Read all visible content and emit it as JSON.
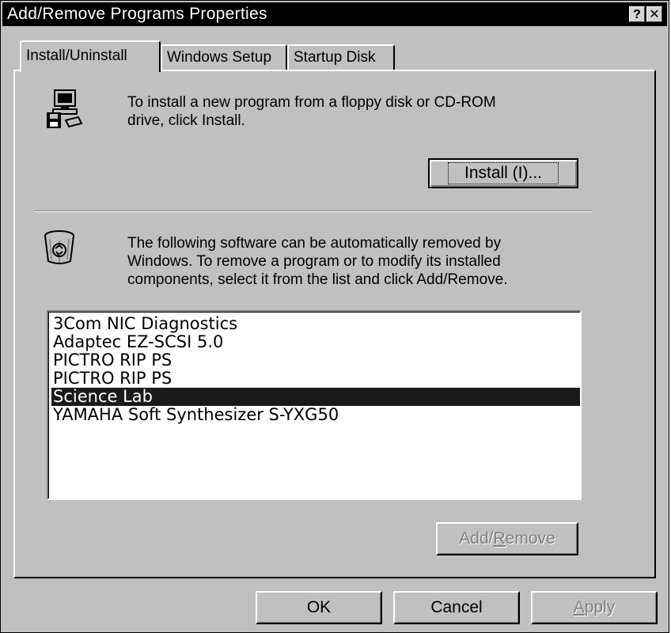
{
  "window": {
    "title": "Add/Remove Programs Properties",
    "help_label": "?",
    "close_label": "✕"
  },
  "tabs": [
    {
      "label": "Install/Uninstall",
      "active": true
    },
    {
      "label": "Windows Setup",
      "active": false
    },
    {
      "label": "Startup Disk",
      "active": false
    }
  ],
  "install_section": {
    "line1": "To install a new program from a floppy disk or CD-ROM",
    "line2": "drive, click Install.",
    "install_button": "Install (I)...",
    "icon": "floppy-computer-icon"
  },
  "uninstall_section": {
    "line1": "The following software can be automatically removed by",
    "line2": "Windows. To remove a program or to modify its installed",
    "line3": "components, select it from the list and click Add/Remove.",
    "icon": "recycle-bin-icon"
  },
  "programs": [
    {
      "name": "3Com NIC Diagnostics",
      "selected": false
    },
    {
      "name": "Adaptec EZ-SCSI 5.0",
      "selected": false
    },
    {
      "name": "PICTRO RIP PS",
      "selected": false
    },
    {
      "name": "PICTRO RIP PS",
      "selected": false
    },
    {
      "name": "Science Lab",
      "selected": true
    },
    {
      "name": "YAMAHA Soft Synthesizer S-YXG50",
      "selected": false
    }
  ],
  "add_remove_button": {
    "prefix": "Add/",
    "accel": "R",
    "suffix": "emove",
    "enabled": false
  },
  "footer": {
    "ok_label": "OK",
    "cancel_label": "Cancel",
    "apply_accel": "A",
    "apply_suffix": "pply",
    "apply_enabled": false
  },
  "colors": {
    "title_bar": "#000000",
    "face": "#c0c0c0",
    "selection": "#1a1a1a"
  }
}
